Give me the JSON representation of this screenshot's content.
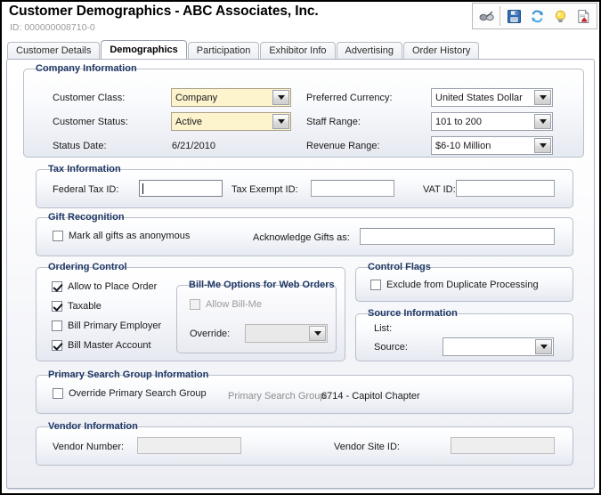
{
  "header": {
    "title": "Customer Demographics - ABC Associates, Inc.",
    "record_id": "ID: 000000008710-0",
    "toolbar": [
      {
        "name": "glasses-icon",
        "label": "View"
      },
      {
        "name": "save-icon",
        "label": "Save"
      },
      {
        "name": "refresh-icon",
        "label": "Refresh"
      },
      {
        "name": "lightbulb-icon",
        "label": "Hints"
      },
      {
        "name": "report-icon",
        "label": "Report"
      }
    ]
  },
  "tabs": [
    {
      "label": "Customer Details",
      "active": false
    },
    {
      "label": "Demographics",
      "active": true
    },
    {
      "label": "Participation",
      "active": false
    },
    {
      "label": "Exhibitor Info",
      "active": false
    },
    {
      "label": "Advertising",
      "active": false
    },
    {
      "label": "Order History",
      "active": false
    }
  ],
  "company_information": {
    "legend": "Company Information",
    "customer_class_label": "Customer Class:",
    "customer_class_value": "Company",
    "customer_status_label": "Customer Status:",
    "customer_status_value": "Active",
    "status_date_label": "Status Date:",
    "status_date_value": "6/21/2010",
    "preferred_currency_label": "Preferred Currency:",
    "preferred_currency_value": "United States Dollar",
    "staff_range_label": "Staff Range:",
    "staff_range_value": "101 to 200",
    "revenue_range_label": "Revenue Range:",
    "revenue_range_value": "$6-10 Million"
  },
  "tax_information": {
    "legend": "Tax Information",
    "federal_tax_id_label": "Federal Tax ID:",
    "federal_tax_id_value": "",
    "tax_exempt_id_label": "Tax Exempt ID:",
    "tax_exempt_id_value": "",
    "vat_id_label": "VAT ID:",
    "vat_id_value": ""
  },
  "gift_recognition": {
    "legend": "Gift Recognition",
    "mark_anonymous_label": "Mark all gifts as anonymous",
    "mark_anonymous_checked": false,
    "acknowledge_label": "Acknowledge Gifts as:",
    "acknowledge_value": ""
  },
  "ordering_control": {
    "legend": "Ordering Control",
    "checkboxes": [
      {
        "label": "Allow to Place Order",
        "checked": true
      },
      {
        "label": "Taxable",
        "checked": true
      },
      {
        "label": "Bill Primary Employer",
        "checked": false
      },
      {
        "label": "Bill Master Account",
        "checked": true
      }
    ],
    "bill_me": {
      "legend": "Bill-Me Options for Web Orders",
      "allow_bill_me_label": "Allow Bill-Me",
      "allow_bill_me_checked": false,
      "override_label": "Override:",
      "override_value": ""
    }
  },
  "control_flags": {
    "legend": "Control Flags",
    "exclude_duplicate_label": "Exclude from Duplicate Processing",
    "exclude_duplicate_checked": false
  },
  "source_information": {
    "legend": "Source Information",
    "list_label": "List:",
    "list_value": "",
    "source_label": "Source:",
    "source_value": ""
  },
  "primary_search_group": {
    "legend": "Primary Search Group Information",
    "override_label": "Override Primary Search Group",
    "override_checked": false,
    "group_label": "Primary Search Group:",
    "group_value": "6714 - Capitol Chapter"
  },
  "vendor_information": {
    "legend": "Vendor Information",
    "vendor_number_label": "Vendor Number:",
    "vendor_number_value": "",
    "vendor_site_id_label": "Vendor Site ID:",
    "vendor_site_id_value": ""
  },
  "colors": {
    "legend_blue": "#1f3864",
    "required_field_yellow": "#fdf3cd",
    "panel_border": "#b9bfcc"
  }
}
